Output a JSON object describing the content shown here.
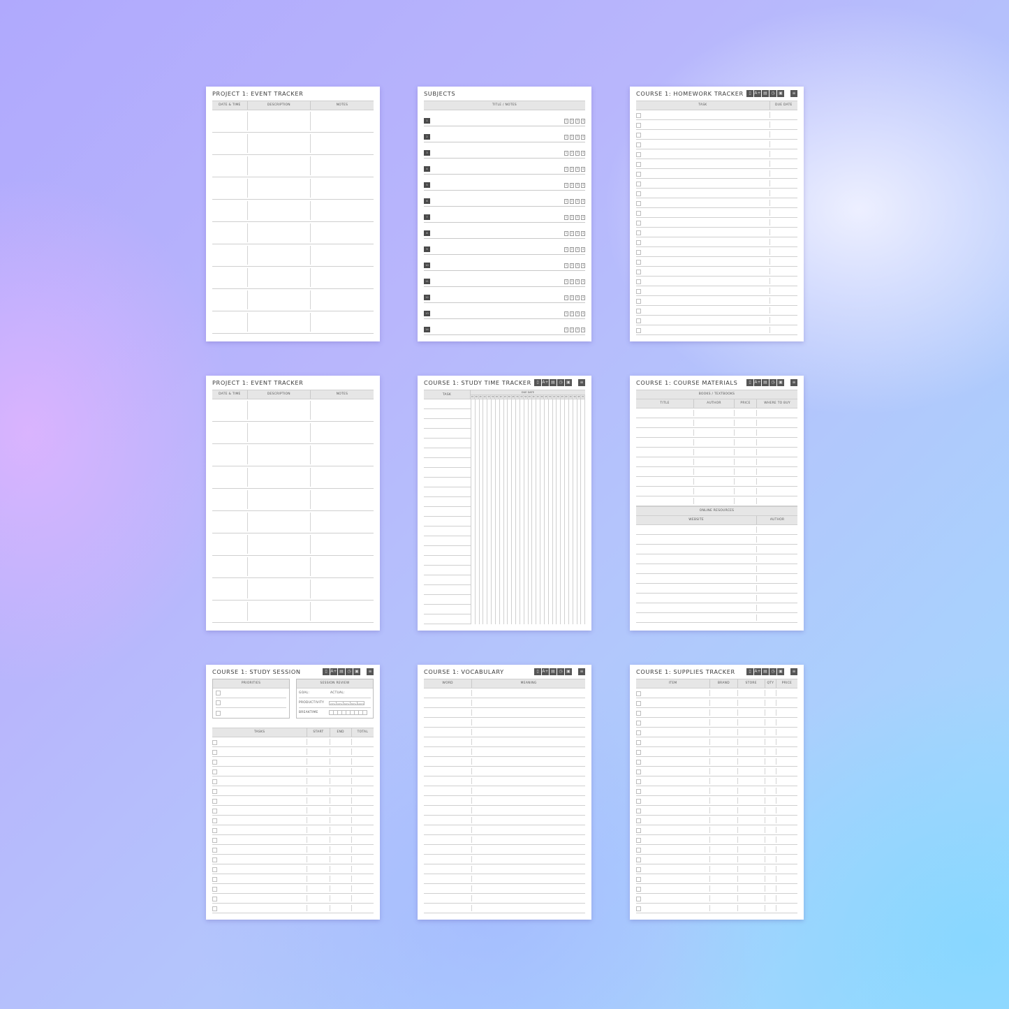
{
  "background": {
    "colors": [
      "#b3abfd",
      "#c5cdfd",
      "#c49bfd",
      "#8fd6fe"
    ]
  },
  "toolbar_icons": [
    "book-icon",
    "grades-icon",
    "document-icon",
    "clock-icon",
    "photo-icon"
  ],
  "toolbar_icon_glyphs": [
    "▯",
    "A+",
    "▤",
    "◷",
    "▣"
  ],
  "menu_icon_glyph": "≡",
  "pages": {
    "event1": {
      "title": "PROJECT 1: EVENT TRACKER",
      "columns": [
        "DATE & TIME",
        "DESCRIPTION",
        "NOTES"
      ],
      "rows": 10
    },
    "subjects": {
      "title": "SUBJECTS",
      "column": "TITLE / NOTES",
      "items": [
        "1",
        "2",
        "3",
        "4",
        "5",
        "6",
        "7",
        "8",
        "9",
        "10",
        "11",
        "12",
        "13",
        "14"
      ],
      "page_icons": [
        "1",
        "2",
        "3",
        "4"
      ]
    },
    "homework": {
      "title": "COURSE 1: HOMEWORK TRACKER",
      "columns": [
        "TASK",
        "DUE DATE"
      ],
      "rows": 23
    },
    "event2": {
      "title": "PROJECT 1: EVENT TRACKER",
      "columns": [
        "DATE & TIME",
        "DESCRIPTION",
        "NOTES"
      ],
      "rows": 10
    },
    "studytime": {
      "title": "COURSE 1: STUDY TIME TRACKER",
      "task_column": "TASK",
      "due_date_column": "DUE DATE",
      "time_slots": [
        "15",
        "30",
        "45",
        "1h",
        "15",
        "30",
        "45",
        "2h",
        "15",
        "30",
        "45",
        "3h",
        "15",
        "30",
        "45",
        "4h",
        "15",
        "30",
        "45",
        "5h",
        "15",
        "30",
        "45",
        "6h",
        "15",
        "30",
        "45",
        "7h"
      ],
      "rows": 23
    },
    "materials": {
      "title": "COURSE 1: COURSE MATERIALS",
      "books_header": "BOOKS / TEXTBOOKS",
      "books_columns": [
        "TITLE",
        "AUTHOR",
        "PRICE",
        "WHERE TO BUY"
      ],
      "books_rows": 10,
      "online_header": "ONLINE RESOURCES",
      "online_columns": [
        "WEBSITE",
        "AUTHOR"
      ],
      "online_rows": 10
    },
    "session": {
      "title": "COURSE 1: STUDY SESSION",
      "priorities_header": "PRIORITIES",
      "priorities_rows": 3,
      "review_header": "SESSION REVIEW",
      "goal_label": "GOAL:",
      "actual_label": "ACTUAL:",
      "productivity_label": "PRODUCTIVITY",
      "productivity_levels": [
        "20%",
        "40%",
        "60%",
        "80%",
        "100%"
      ],
      "breaktime_label": "BREAKTIME",
      "breaktime_boxes": 9,
      "task_columns": [
        "TASKS",
        "START",
        "END",
        "TOTAL"
      ],
      "task_rows": 18
    },
    "vocabulary": {
      "title": "COURSE 1: VOCABULARY",
      "columns": [
        "WORD",
        "MEANING"
      ],
      "rows": 23
    },
    "supplies": {
      "title": "COURSE 1: SUPPLIES TRACKER",
      "columns": [
        "ITEM",
        "BRAND",
        "STORE",
        "QTY",
        "PRICE"
      ],
      "rows": 23
    }
  }
}
